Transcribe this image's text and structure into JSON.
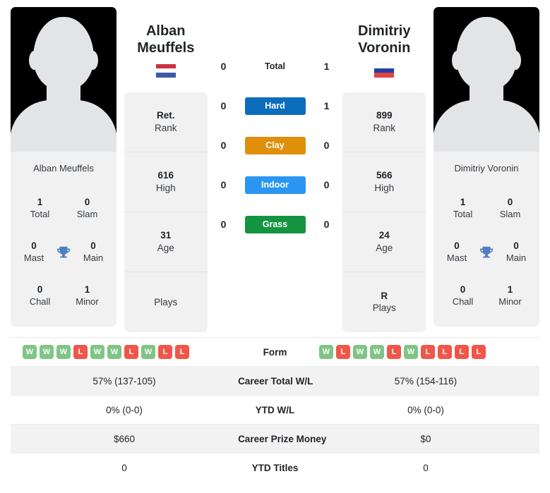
{
  "colors": {
    "hard": "#0d6dbd",
    "clay": "#df8f0a",
    "indoor": "#2b96f1",
    "grass": "#149440",
    "win": "#7fc584",
    "loss": "#f0564a",
    "trophy": "#4f7fbf",
    "card_bg": "#f1f1f1",
    "row_shade": "#f2f2f2"
  },
  "left_player": {
    "name": "Alban Meuffels",
    "name_line1": "Alban",
    "name_line2": "Meuffels",
    "photo_caption": "Alban Meuffels",
    "flag": {
      "name": "netherlands-flag",
      "stripes": [
        "#c8313e",
        "#ffffff",
        "#3b5ba5"
      ]
    },
    "rank_cells": [
      {
        "value": "Ret.",
        "label": "Rank"
      },
      {
        "value": "616",
        "label": "High"
      },
      {
        "value": "31",
        "label": "Age"
      },
      {
        "value": "",
        "label": "Plays"
      }
    ],
    "titles": [
      {
        "value": "1",
        "label": "Total"
      },
      {
        "value": "0",
        "label": "Slam"
      },
      {
        "value": "0",
        "label": "Mast"
      },
      {
        "value": "0",
        "label": "Main"
      },
      {
        "value": "0",
        "label": "Chall"
      },
      {
        "value": "1",
        "label": "Minor"
      }
    ],
    "form": [
      "W",
      "W",
      "W",
      "L",
      "W",
      "W",
      "L",
      "W",
      "L",
      "L"
    ],
    "career_total_wl": "57% (137-105)",
    "ytd_wl": "0% (0-0)",
    "career_prize_money": "$660",
    "ytd_titles": "0"
  },
  "right_player": {
    "name": "Dimitriy Voronin",
    "name_line1": "Dimitriy",
    "name_line2": "Voronin",
    "photo_caption": "Dimitriy Voronin",
    "flag": {
      "name": "russia-flag",
      "stripes": [
        "#ffffff",
        "#2040a8",
        "#e2433f"
      ]
    },
    "rank_cells": [
      {
        "value": "899",
        "label": "Rank"
      },
      {
        "value": "566",
        "label": "High"
      },
      {
        "value": "24",
        "label": "Age"
      },
      {
        "value": "R",
        "label": "Plays"
      }
    ],
    "titles": [
      {
        "value": "1",
        "label": "Total"
      },
      {
        "value": "0",
        "label": "Slam"
      },
      {
        "value": "0",
        "label": "Mast"
      },
      {
        "value": "0",
        "label": "Main"
      },
      {
        "value": "0",
        "label": "Chall"
      },
      {
        "value": "1",
        "label": "Minor"
      }
    ],
    "form": [
      "W",
      "L",
      "W",
      "W",
      "L",
      "W",
      "L",
      "L",
      "L",
      "L"
    ],
    "career_total_wl": "57% (154-116)",
    "ytd_wl": "0% (0-0)",
    "career_prize_money": "$0",
    "ytd_titles": "0"
  },
  "head_to_head": [
    {
      "surface": "Total",
      "left": "0",
      "right": "1",
      "color": ""
    },
    {
      "surface": "Hard",
      "left": "0",
      "right": "1",
      "color": "#0d6dbd"
    },
    {
      "surface": "Clay",
      "left": "0",
      "right": "0",
      "color": "#df8f0a"
    },
    {
      "surface": "Indoor",
      "left": "0",
      "right": "0",
      "color": "#2b96f1"
    },
    {
      "surface": "Grass",
      "left": "0",
      "right": "0",
      "color": "#149440"
    }
  ],
  "stats_rows": [
    {
      "label": "Form",
      "left": "",
      "right": "",
      "type": "form",
      "shaded": false
    },
    {
      "label": "Career Total W/L",
      "left": "57% (137-105)",
      "right": "57% (154-116)",
      "type": "text",
      "shaded": true
    },
    {
      "label": "YTD W/L",
      "left": "0% (0-0)",
      "right": "0% (0-0)",
      "type": "text",
      "shaded": false
    },
    {
      "label": "Career Prize Money",
      "left": "$660",
      "right": "$0",
      "type": "text",
      "shaded": true
    },
    {
      "label": "YTD Titles",
      "left": "0",
      "right": "0",
      "type": "text",
      "shaded": false
    }
  ]
}
